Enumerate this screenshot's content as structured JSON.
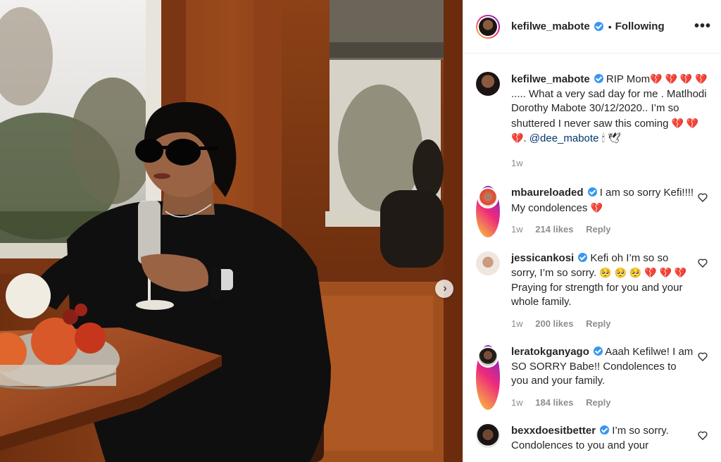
{
  "post": {
    "username": "kefilwe_mabote",
    "follow_state": "Following",
    "separator": "•",
    "more": "•••",
    "carousel_next": "›",
    "caption": {
      "username": "kefilwe_mabote",
      "text_1": " RIP Mom",
      "hearts_1": "💔 💔 💔",
      "line_2_hearts": "💔",
      "text_2": " ..... What a very sad day for me . Matlhodi Dorothy Mabote 30/12/2020.. I’m so shuttered I never saw this coming ",
      "hearts_2": "💔 💔 💔",
      "text_3": ". ",
      "mention": "@dee_mabote",
      "emoji_end": "🕯 🕊",
      "time": "1w"
    }
  },
  "comments": [
    {
      "username": "mbaureloaded",
      "text": " I am so sorry Kefi!!!! My condolences ",
      "emoji": "💔",
      "time": "1w",
      "likes": "214 likes",
      "reply": "Reply"
    },
    {
      "username": "jessicankosi",
      "text": " Kefi oh I’m so so sorry, I’m so sorry. ",
      "emoji": "🥺 🥺 🥺 💔 💔 💔",
      "text_after": " Praying for strength for you and your whole family.",
      "time": "1w",
      "likes": "200 likes",
      "reply": "Reply"
    },
    {
      "username": "leratokganyago",
      "text": " Aaah Kefilwe! I am SO SORRY Babe!! Condolences to you and your family.",
      "time": "1w",
      "likes": "184 likes",
      "reply": "Reply"
    },
    {
      "username": "bexxdoesitbetter",
      "text": " I’m so sorry. Condolences to you and your"
    }
  ],
  "colors": {
    "verified": "#3897f0",
    "mention": "#00376b",
    "meta": "#8e8e8e",
    "text": "#262626"
  }
}
